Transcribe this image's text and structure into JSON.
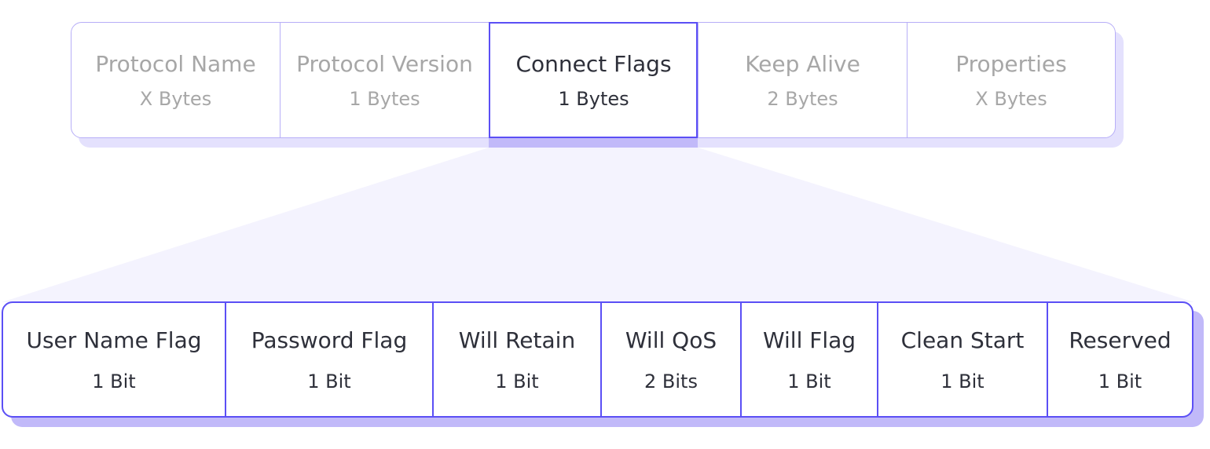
{
  "colors": {
    "accent": "#5b4ff5",
    "accent_light": "#b7aef7",
    "shadow_top": "#e4e1fd",
    "shadow_bottom": "#c1b9f9",
    "funnel": "#f4f3fe",
    "text_active": "#2e303a",
    "text_muted": "#a7a7a7"
  },
  "top_fields": [
    {
      "name": "Protocol Name",
      "size": "X Bytes"
    },
    {
      "name": "Protocol Version",
      "size": "1 Bytes"
    },
    {
      "name": "Connect Flags",
      "size": "1 Bytes",
      "active": true
    },
    {
      "name": "Keep Alive",
      "size": "2 Bytes"
    },
    {
      "name": "Properties",
      "size": "X Bytes"
    }
  ],
  "flag_fields": [
    {
      "name": "User Name Flag",
      "size": "1 Bit"
    },
    {
      "name": "Password Flag",
      "size": "1 Bit"
    },
    {
      "name": "Will Retain",
      "size": "1 Bit"
    },
    {
      "name": "Will QoS",
      "size": "2 Bits"
    },
    {
      "name": "Will Flag",
      "size": "1 Bit"
    },
    {
      "name": "Clean Start",
      "size": "1 Bit"
    },
    {
      "name": "Reserved",
      "size": "1 Bit"
    }
  ]
}
